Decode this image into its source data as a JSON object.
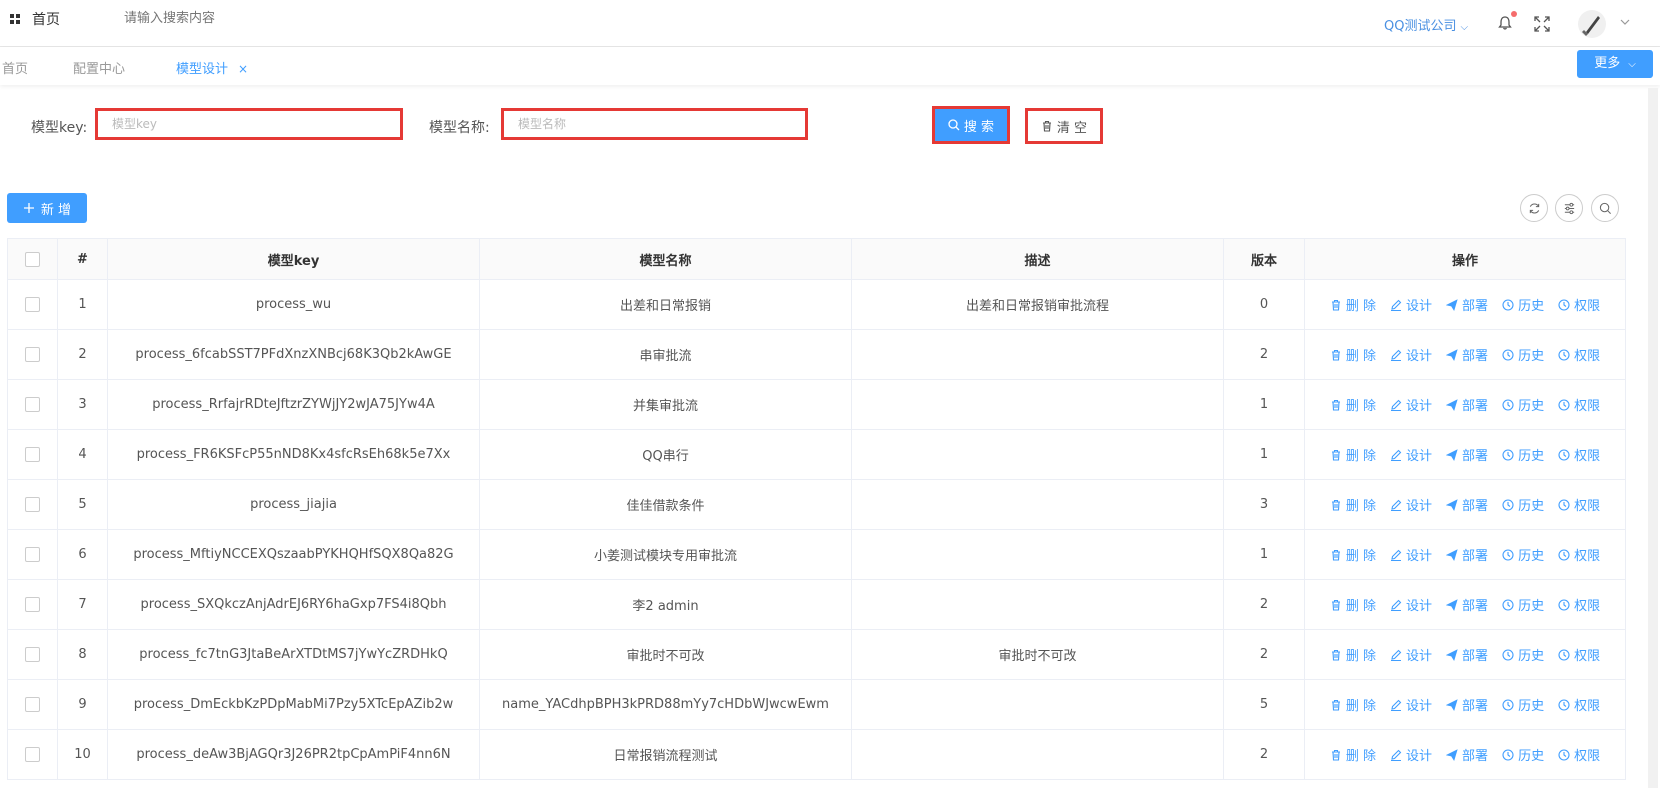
{
  "header": {
    "home_label": "首页",
    "search_placeholder": "请输入搜索内容",
    "company": "QQ测试公司"
  },
  "tabs": [
    {
      "label": "首页"
    },
    {
      "label": "配置中心"
    },
    {
      "label": "模型设计",
      "close": "×"
    }
  ],
  "more_label": "更多",
  "filters": {
    "key_label": "模型key:",
    "key_placeholder": "模型key",
    "name_label": "模型名称:",
    "name_placeholder": "模型名称",
    "search_button": "搜 索",
    "clear_button": "清 空"
  },
  "toolbar": {
    "add_button": "新 增"
  },
  "table": {
    "columns": [
      "#",
      "模型key",
      "模型名称",
      "描述",
      "版本",
      "操作"
    ],
    "actions": [
      "删 除",
      "设计",
      "部署",
      "历史",
      "权限"
    ],
    "rows": [
      {
        "index": "1",
        "key": "process_wu",
        "name": "出差和日常报销",
        "desc": "出差和日常报销审批流程",
        "version": "0"
      },
      {
        "index": "2",
        "key": "process_6fcabSST7PFdXnzXNBcj68K3Qb2kAwGE",
        "name": "串审批流",
        "desc": "",
        "version": "2"
      },
      {
        "index": "3",
        "key": "process_RrfajrRDteJftzrZYWjJY2wJA75JYw4A",
        "name": "并集审批流",
        "desc": "",
        "version": "1"
      },
      {
        "index": "4",
        "key": "process_FR6KSFcP55nND8Kx4sfcRsEh68k5e7Xx",
        "name": "QQ串行",
        "desc": "",
        "version": "1"
      },
      {
        "index": "5",
        "key": "process_jiajia",
        "name": "佳佳借款条件",
        "desc": "",
        "version": "3"
      },
      {
        "index": "6",
        "key": "process_MftiyNCCEXQszaabPYKHQHfSQX8Qa82G",
        "name": "小姜测试模块专用审批流",
        "desc": "",
        "version": "1"
      },
      {
        "index": "7",
        "key": "process_SXQkczAnjAdrEJ6RY6haGxp7FS4i8Qbh",
        "name": "李2 admin",
        "desc": "",
        "version": "2"
      },
      {
        "index": "8",
        "key": "process_fc7tnG3JtaBeArXTDtMS7jYwYcZRDHkQ",
        "name": "审批时不可改",
        "desc": "审批时不可改",
        "version": "2"
      },
      {
        "index": "9",
        "key": "process_DmEckbKzPDpMabMi7Pzy5XTcEpAZib2w",
        "name": "name_YACdhpBPH3kPRD88mYy7cHDbWJwcwEwm",
        "desc": "",
        "version": "5"
      },
      {
        "index": "10",
        "key": "process_deAw3BjAGQr3J26PR2tpCpAmPiF4nn6N",
        "name": "日常报销流程测试",
        "desc": "",
        "version": "2"
      }
    ]
  }
}
